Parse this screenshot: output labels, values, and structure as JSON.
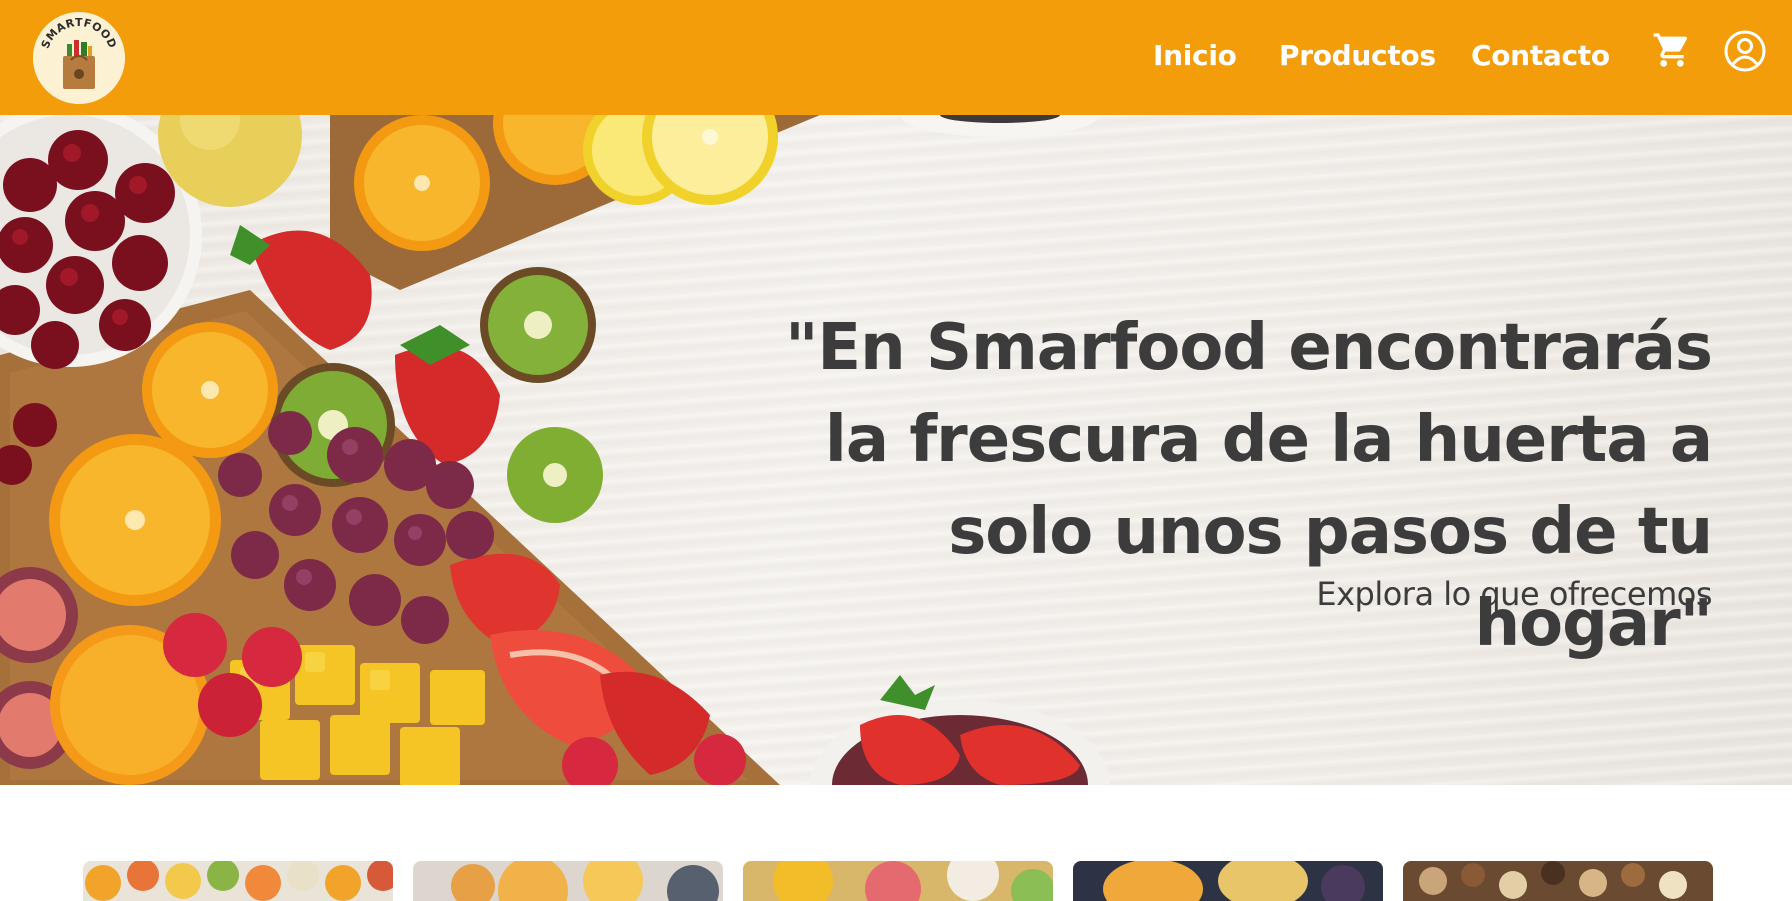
{
  "header": {
    "logo_text": "SMARTFOOD",
    "nav": [
      {
        "label": "Inicio"
      },
      {
        "label": "Productos"
      },
      {
        "label": "Contacto"
      }
    ],
    "icons": {
      "cart": "shopping-cart-icon",
      "user": "user-account-icon"
    }
  },
  "hero": {
    "quote": "\"En Smarfood encontrarás la frescura de la huerta a solo unos pasos de tu hogar\"",
    "subtitle": "Explora lo que ofrecemos"
  },
  "product_cards": [
    {
      "image": "citrus-fruits-photo"
    },
    {
      "image": "grapefruit-photo"
    },
    {
      "image": "tropical-fruits-photo"
    },
    {
      "image": "melon-fruits-photo"
    },
    {
      "image": "nuts-and-dried-fruits-photo"
    }
  ],
  "colors": {
    "header_bg": "#F29D09",
    "nav_text": "#FFFFFF",
    "hero_text": "#3C3C3C",
    "logo_bg": "#FDF1D3"
  }
}
